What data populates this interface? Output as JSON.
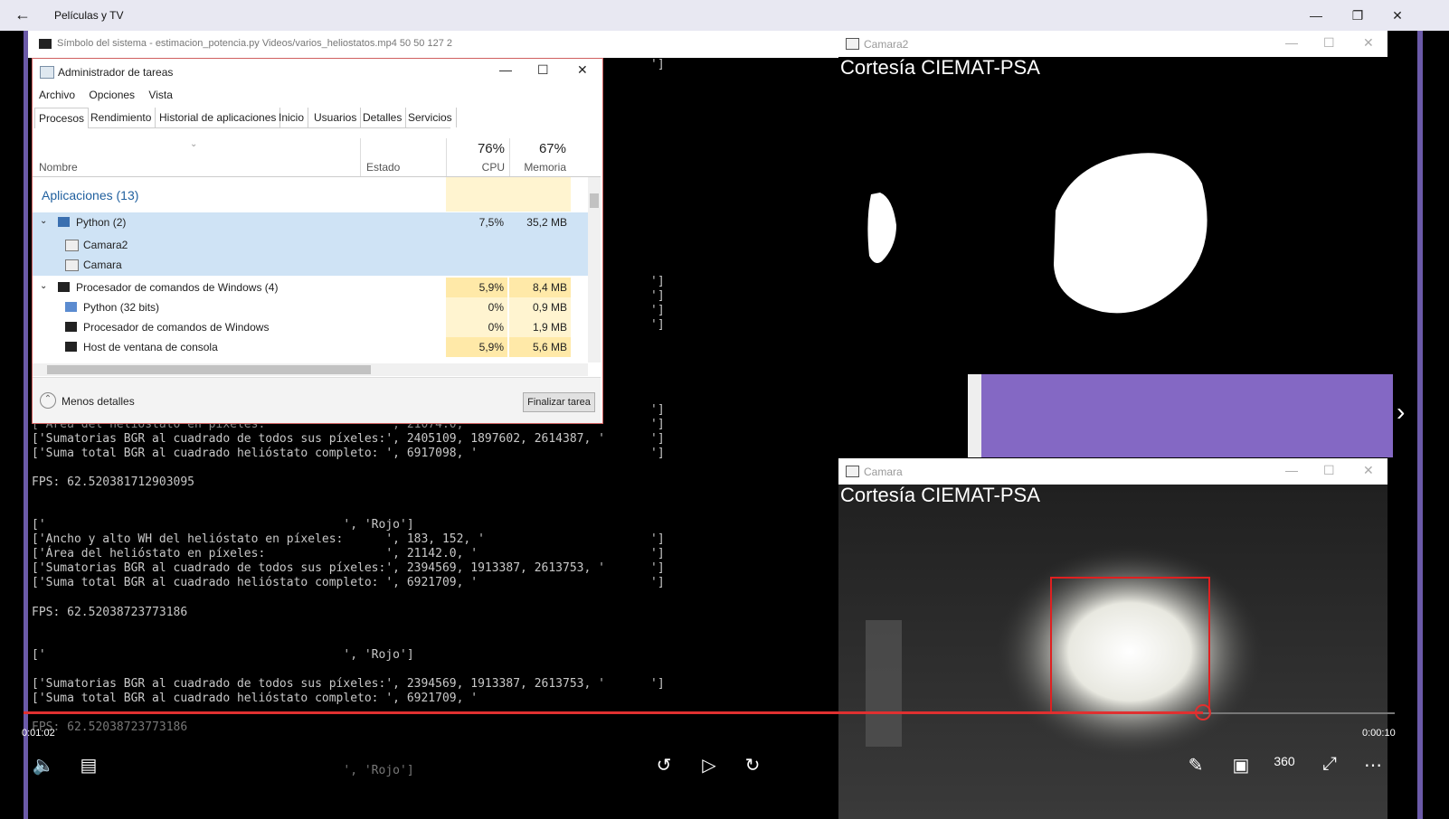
{
  "app": {
    "back_icon": "arrow-left-icon",
    "title": "Películas y TV"
  },
  "cmd_window": {
    "title": "Símbolo del sistema - estimacion_potencia.py  Videos/varios_heliostatos.mp4 50 50 127 2"
  },
  "console_lines": [
    "['Área del helióstato en píxeles:                 ', 21074.0,",
    "['Sumatorias BGR al cuadrado de todos sus píxeles:', 2405109, 1897602, 2614387, '",
    "['Suma total BGR al cuadrado helióstato completo: ', 6917098, '",
    "FPS: 62.520381712903095",
    "['                                          ', 'Rojo']",
    "['Ancho y alto WH del helióstato en píxeles:      ', 183, 152, '",
    "['Área del helióstato en píxeles:                 ', 21142.0, '",
    "['Sumatorias BGR al cuadrado de todos sus píxeles:', 2394569, 1913387, 2613753, '",
    "['Suma total BGR al cuadrado helióstato completo: ', 6921709, '",
    "FPS: 62.52038723773186",
    "['                                          ', 'Rojo']",
    "['Sumatorias BGR al cuadrado de todos sus píxeles:', 2394569, 1913387, 2613753, '",
    "['Suma total BGR al cuadrado helióstato completo: ', 6921709, '",
    "FPS: 62.52038723773186",
    "                                            ', 'Rojo']"
  ],
  "console_brackets": [
    "']",
    "']",
    "']",
    "']",
    "']",
    "']",
    "']",
    "']",
    "']",
    "']",
    "']",
    "']",
    "']",
    "']"
  ],
  "camara2": {
    "title": "Camara2",
    "caption": "Cortesía CIEMAT-PSA"
  },
  "camara": {
    "title": "Camara",
    "caption": "Cortesía CIEMAT-PSA"
  },
  "task_manager": {
    "title": "Administrador de tareas",
    "menu": [
      "Archivo",
      "Opciones",
      "Vista"
    ],
    "tabs": [
      "Procesos",
      "Rendimiento",
      "Historial de aplicaciones",
      "Inicio",
      "Usuarios",
      "Detalles",
      "Servicios"
    ],
    "columns": {
      "name": "Nombre",
      "status": "Estado",
      "cpu_pct": "76%",
      "cpu": "CPU",
      "mem_pct": "67%",
      "mem": "Memoria"
    },
    "group": "Aplicaciones (13)",
    "rows": [
      {
        "name": "Python (2)",
        "cpu": "7,5%",
        "mem": "35,2 MB"
      },
      {
        "name": "Camara2",
        "cpu": "",
        "mem": ""
      },
      {
        "name": "Camara",
        "cpu": "",
        "mem": ""
      },
      {
        "name": "Procesador de comandos de Windows (4)",
        "cpu": "5,9%",
        "mem": "8,4 MB"
      },
      {
        "name": "Python (32 bits)",
        "cpu": "0%",
        "mem": "0,9 MB"
      },
      {
        "name": "Procesador de comandos de Windows",
        "cpu": "0%",
        "mem": "1,9 MB"
      },
      {
        "name": "Host de ventana de consola",
        "cpu": "5,9%",
        "mem": "5,6 MB"
      }
    ],
    "less_details": "Menos detalles",
    "end_task": "Finalizar tarea"
  },
  "player": {
    "current_time": "0:01:02",
    "remaining_time": "0:00:10",
    "progress": 0.86
  }
}
